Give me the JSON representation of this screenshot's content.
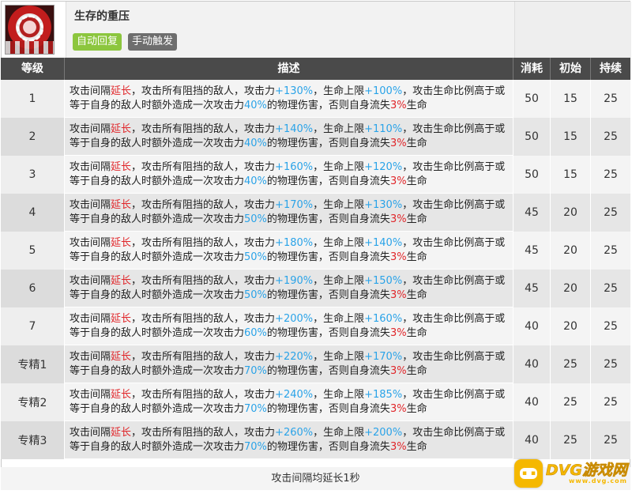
{
  "skill": {
    "name": "生存的重压",
    "recovery_tag": "自动回复",
    "trigger_tag": "手动触发",
    "icon": "skill-emblem-icon"
  },
  "table": {
    "headers": {
      "level": "等级",
      "desc": "描述",
      "cost": "消耗",
      "initial": "初始",
      "duration": "持续"
    },
    "desc_template": {
      "part1": "攻击间隔",
      "extend": "延长",
      "part2": "，攻击所有阻挡的敌人，攻击力",
      "part3": "，生命上限",
      "part4": "，攻击生命比例高于或等于自身的敌人时额外造成一次攻击力",
      "part5": "的物理伤害，否则自身流失",
      "loss": "3%",
      "part6": "生命"
    },
    "rows": [
      {
        "level": "1",
        "atk": "+130%",
        "hp": "+100%",
        "extra": "40%",
        "cost": "50",
        "initial": "15",
        "duration": "25"
      },
      {
        "level": "2",
        "atk": "+140%",
        "hp": "+110%",
        "extra": "40%",
        "cost": "50",
        "initial": "15",
        "duration": "25"
      },
      {
        "level": "3",
        "atk": "+160%",
        "hp": "+120%",
        "extra": "40%",
        "cost": "50",
        "initial": "15",
        "duration": "25"
      },
      {
        "level": "4",
        "atk": "+170%",
        "hp": "+130%",
        "extra": "50%",
        "cost": "45",
        "initial": "20",
        "duration": "25"
      },
      {
        "level": "5",
        "atk": "+180%",
        "hp": "+140%",
        "extra": "50%",
        "cost": "45",
        "initial": "20",
        "duration": "25"
      },
      {
        "level": "6",
        "atk": "+190%",
        "hp": "+150%",
        "extra": "50%",
        "cost": "45",
        "initial": "20",
        "duration": "25"
      },
      {
        "level": "7",
        "atk": "+200%",
        "hp": "+160%",
        "extra": "60%",
        "cost": "40",
        "initial": "20",
        "duration": "25"
      },
      {
        "level": "专精1",
        "atk": "+220%",
        "hp": "+170%",
        "extra": "70%",
        "cost": "40",
        "initial": "25",
        "duration": "25"
      },
      {
        "level": "专精2",
        "atk": "+240%",
        "hp": "+185%",
        "extra": "70%",
        "cost": "40",
        "initial": "25",
        "duration": "25"
      },
      {
        "level": "专精3",
        "atk": "+260%",
        "hp": "+200%",
        "extra": "70%",
        "cost": "40",
        "initial": "25",
        "duration": "25"
      }
    ],
    "footer": "攻击间隔均延长1秒"
  },
  "watermark": {
    "brand": "DVG游戏网",
    "url": "www.dvg.com",
    "icon": "gamepad-icon"
  },
  "colors": {
    "header_bg": "#4a4a4a",
    "highlight_red": "#e0262a",
    "highlight_blue": "#2aa3e8",
    "tag_green": "#8cc63e",
    "tag_gray": "#6e6e6e"
  }
}
